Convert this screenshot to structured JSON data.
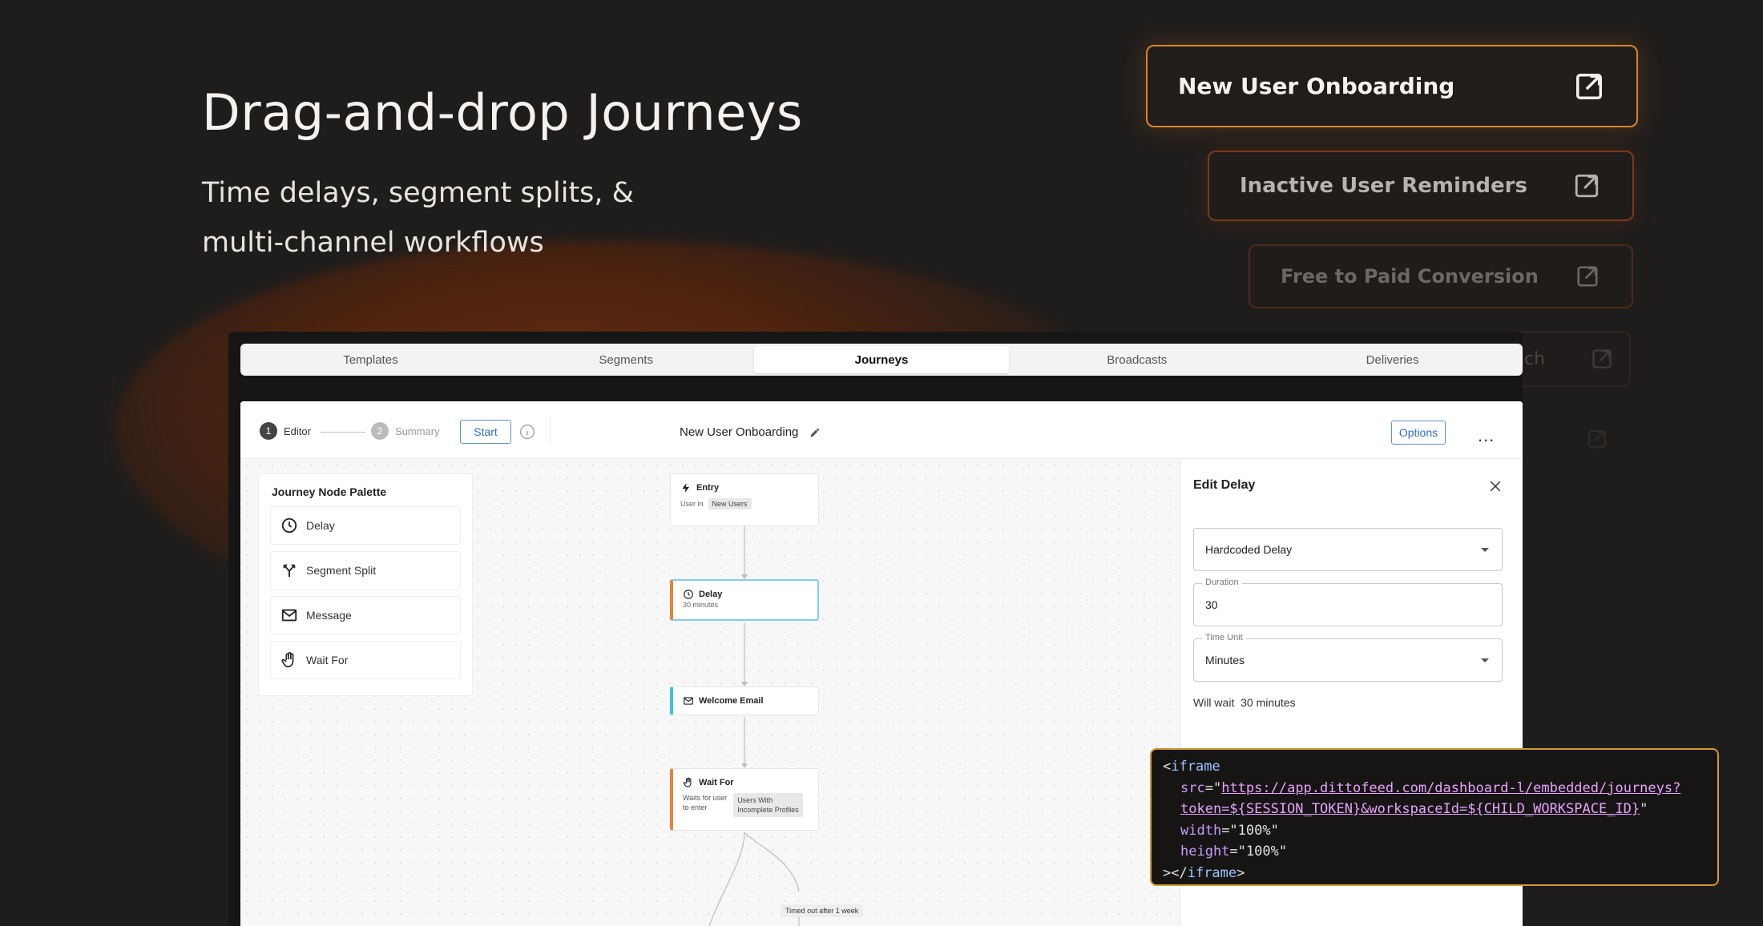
{
  "hero": {
    "title": "Drag-and-drop Journeys",
    "subtitle_line1": "Time delays, segment splits, &",
    "subtitle_line2": "multi-channel workflows"
  },
  "journey_cards": [
    {
      "label": "New User Onboarding"
    },
    {
      "label": "Inactive User Reminders"
    },
    {
      "label": "Free to Paid Conversion"
    },
    {
      "label": "ch"
    }
  ],
  "app": {
    "tabs": [
      {
        "label": "Templates"
      },
      {
        "label": "Segments"
      },
      {
        "label": "Journeys"
      },
      {
        "label": "Broadcasts"
      },
      {
        "label": "Deliveries"
      }
    ],
    "active_tab": "Journeys",
    "toolbar": {
      "step1_num": "1",
      "step1_label": "Editor",
      "step2_num": "2",
      "step2_label": "Summary",
      "start_label": "Start",
      "journey_name": "New User Onboarding",
      "options_label": "Options",
      "more": "..."
    },
    "palette": {
      "title": "Journey Node Palette",
      "items": [
        {
          "label": "Delay",
          "icon": "clock-icon"
        },
        {
          "label": "Segment Split",
          "icon": "split-icon"
        },
        {
          "label": "Message",
          "icon": "mail-icon"
        },
        {
          "label": "Wait For",
          "icon": "hand-icon"
        }
      ]
    },
    "nodes": {
      "entry": {
        "title": "Entry",
        "meta_prefix": "User in",
        "meta_chip": "New Users"
      },
      "delay": {
        "title": "Delay",
        "meta": "30 minutes"
      },
      "email": {
        "title": "Welcome Email"
      },
      "wait": {
        "title": "Wait For",
        "meta_line1": "Waits for user",
        "meta_line2": "to enter",
        "chip_line1": "Users With",
        "chip_line2": "Incomplete Profiles"
      },
      "timed_out": "Timed out after 1 week"
    },
    "edit_panel": {
      "title": "Edit Delay",
      "delay_type": "Hardcoded Delay",
      "duration_label": "Duration",
      "duration_value": "30",
      "time_unit_label": "Time Unit",
      "time_unit_value": "Minutes",
      "summary": "Will wait  30 minutes"
    }
  },
  "code": {
    "line1_tag": "iframe",
    "src_attr": "src",
    "src_value_line1": "https://app.dittofeed.com/dashboard-l/embedded/journeys?",
    "src_value_line2": "token=${SESSION_TOKEN}&workspaceId=${CHILD_WORKSPACE_ID}",
    "width_attr": "width",
    "width_value": "100%",
    "height_attr": "height",
    "height_value": "100%",
    "close_tag": "iframe"
  },
  "colors": {
    "accent_orange": "#d9822b",
    "code_border": "#d49a2c",
    "link_blue": "#2f6fc0"
  }
}
